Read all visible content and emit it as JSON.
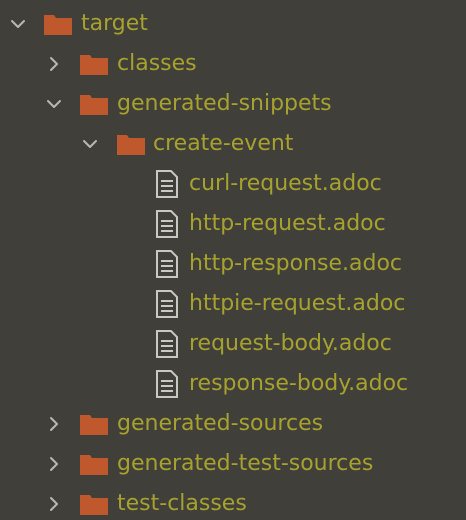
{
  "colors": {
    "background": "#403f3a",
    "text": "#a7a22e",
    "folder": "#c0582d",
    "chevron": "#b9b9b4",
    "file_icon": "#c9c9c4"
  },
  "tree": {
    "root": {
      "label": "target",
      "expanded": true,
      "icon": "folder-icon"
    },
    "items": [
      {
        "label": "classes",
        "expanded": false,
        "icon": "folder-icon"
      },
      {
        "label": "generated-snippets",
        "expanded": true,
        "icon": "folder-icon"
      },
      {
        "label": "create-event",
        "expanded": true,
        "icon": "folder-icon"
      },
      {
        "label": "curl-request.adoc",
        "icon": "file-text-icon"
      },
      {
        "label": "http-request.adoc",
        "icon": "file-text-icon"
      },
      {
        "label": "http-response.adoc",
        "icon": "file-text-icon"
      },
      {
        "label": "httpie-request.adoc",
        "icon": "file-text-icon"
      },
      {
        "label": "request-body.adoc",
        "icon": "file-text-icon"
      },
      {
        "label": "response-body.adoc",
        "icon": "file-text-icon"
      },
      {
        "label": "generated-sources",
        "expanded": false,
        "icon": "folder-icon"
      },
      {
        "label": "generated-test-sources",
        "expanded": false,
        "icon": "folder-icon"
      },
      {
        "label": "test-classes",
        "expanded": false,
        "icon": "folder-icon"
      }
    ]
  }
}
